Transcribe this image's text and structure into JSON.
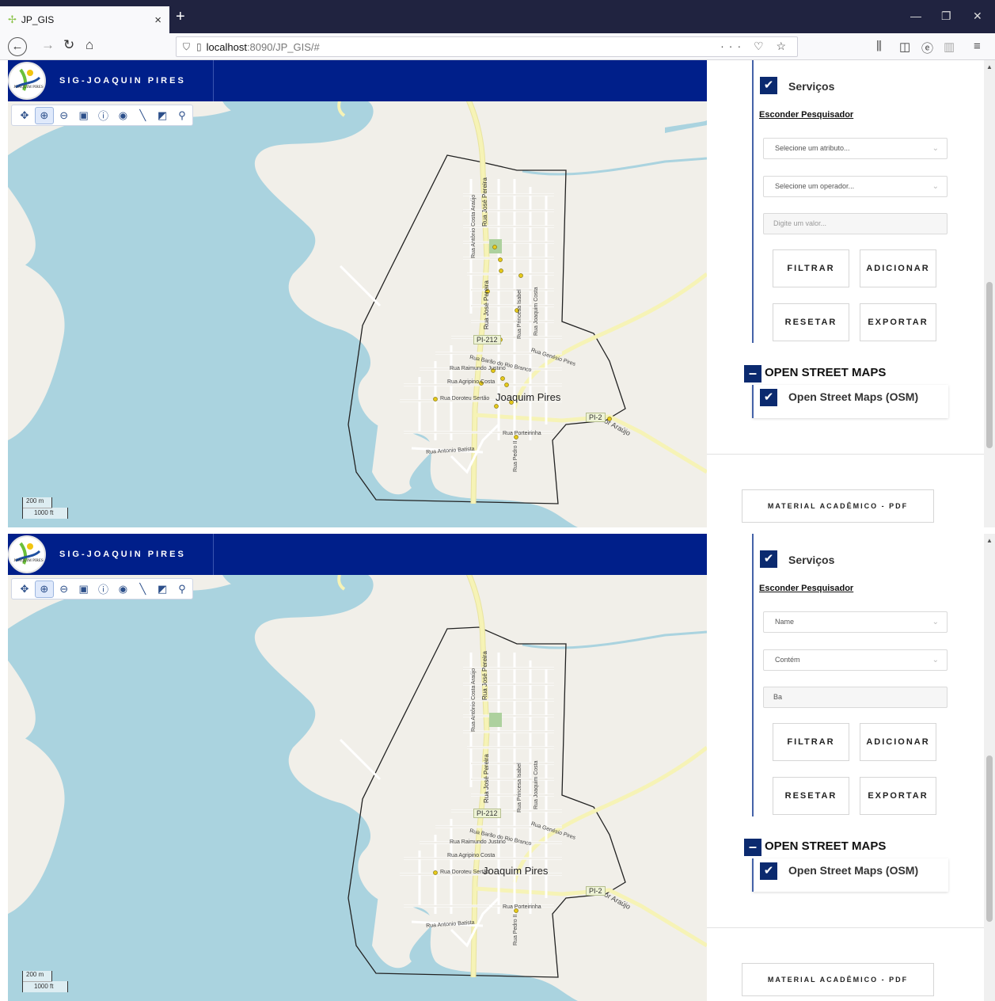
{
  "browser": {
    "tab_title": "JP_GIS",
    "tab_close": "×",
    "new_tab": "+",
    "url_host": "localhost",
    "url_path": ":8090/JP_GIS/#",
    "url_actions": "··· ♡ ☆",
    "min_icon": "—",
    "max_icon": "❐",
    "close_icon": "✕"
  },
  "app": {
    "title": "SIG-JOAQUIN PIRES",
    "logo_text": "JOAQUIM PIRES"
  },
  "map": {
    "scale_m": "200 m",
    "scale_ft": "1000 ft",
    "town": "Joaquim Pires",
    "road_pi212": "PI-212",
    "road_pi2": "PI-2",
    "streets": {
      "jose_pereira": "Rua José Pereira",
      "antonio_costa_araujo": "Rua Antônio Costa Araújo",
      "princesa_isabel": "Rua Princesa Isabel",
      "joaquim_costa": "Rua Joaquim Costa",
      "genesio_pires": "Rua Genésio Pires",
      "barao_rio_branco": "Rua Barão do Rio Branco",
      "raimundo_justino": "Rua Raimundo Justino",
      "agripino_costa": "Rua Agripino Costa",
      "doroteu_sertao": "Rua Doroteu Sertão",
      "porteirinha": "Rua Porteirinha",
      "pedro_ii": "Rua Pedro II",
      "antonio_batista": "Rua Antonio Batista",
      "dor_araujo": "dor Araújo"
    }
  },
  "panel_top": {
    "layer_label": "Serviços",
    "hide_search": "Esconder Pesquisador",
    "attribute": "Selecione um atributo...",
    "operator": "Selecione um operador...",
    "value": "Digite um valor...",
    "filter": "FILTRAR",
    "add": "ADICIONAR",
    "reset": "RESETAR",
    "export": "EXPORTAR",
    "group_title": "OPEN STREET MAPS",
    "osm_label": "Open Street Maps (OSM)",
    "pdf": "MATERIAL ACADÊMICO - PDF"
  },
  "panel_bottom": {
    "layer_label": "Serviços",
    "hide_search": "Esconder Pesquisador",
    "attribute": "Name",
    "operator": "Contém",
    "value": "Ba",
    "filter": "FILTRAR",
    "add": "ADICIONAR",
    "reset": "RESETAR",
    "export": "EXPORTAR",
    "group_title": "OPEN STREET MAPS",
    "osm_label": "Open Street Maps (OSM)",
    "pdf": "MATERIAL ACADÊMICO - PDF"
  }
}
